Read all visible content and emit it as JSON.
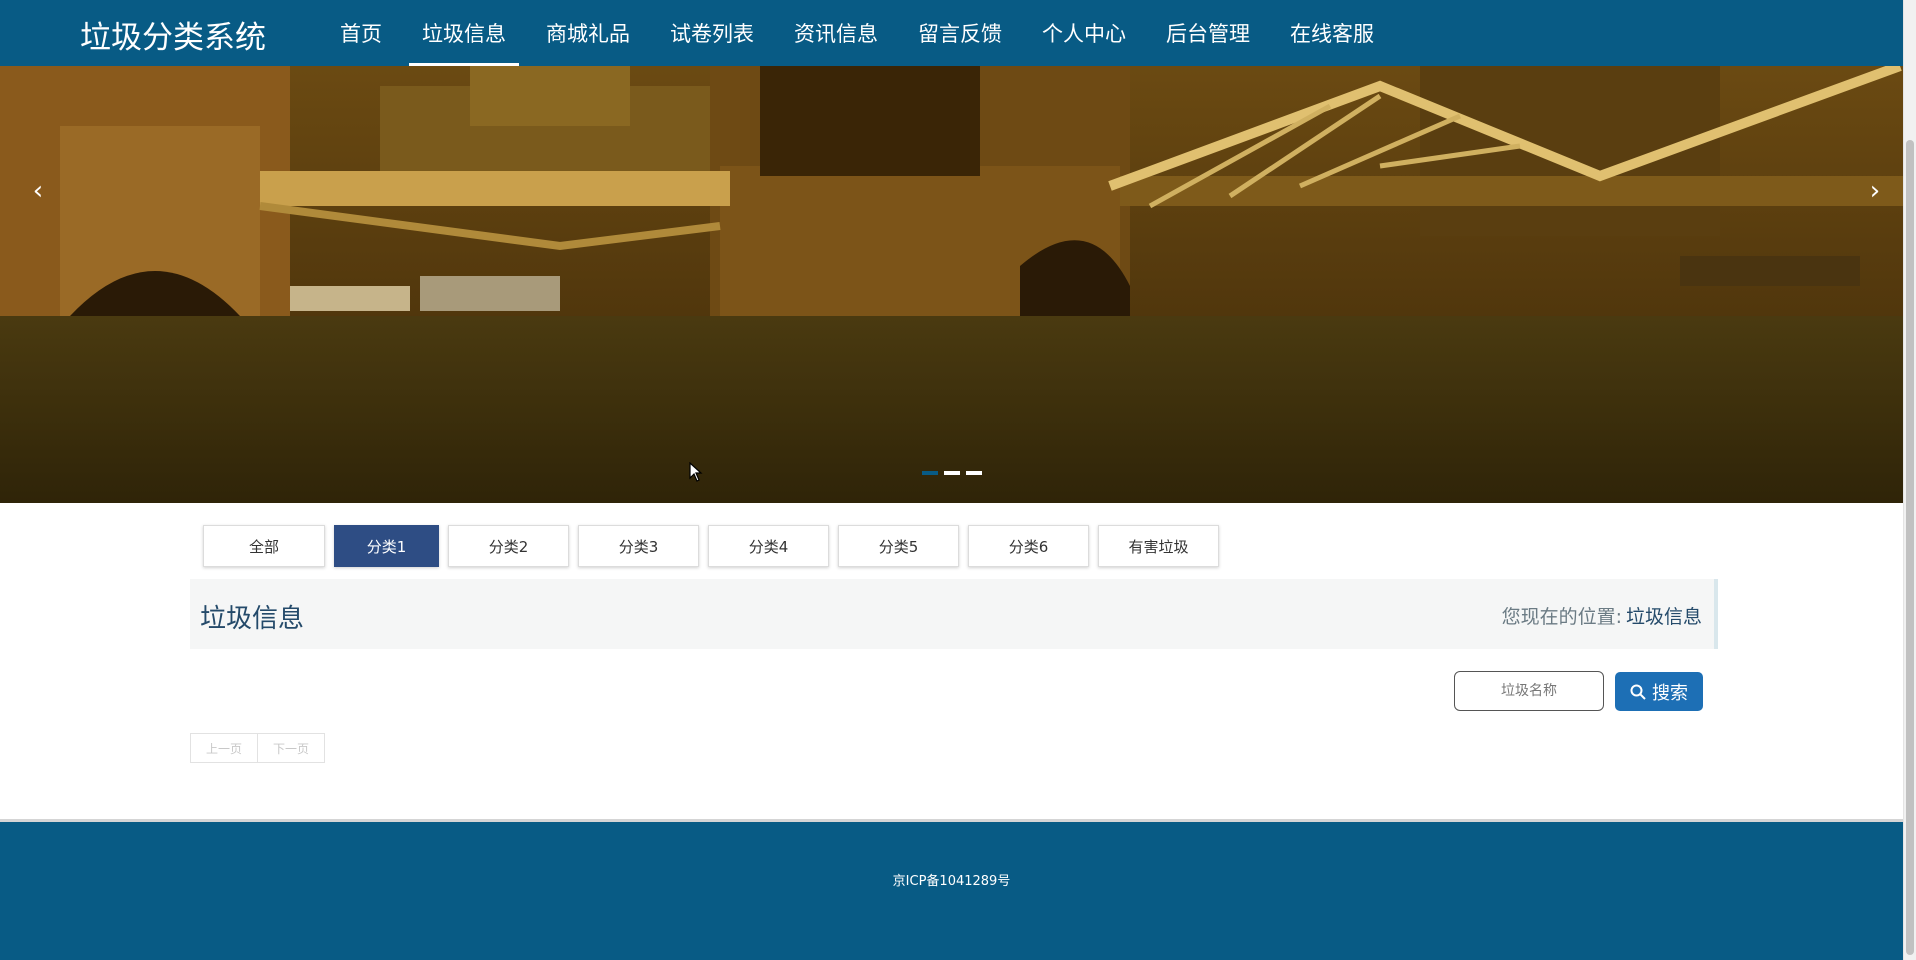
{
  "header": {
    "logo": "垃圾分类系统",
    "nav": [
      {
        "label": "首页",
        "active": false
      },
      {
        "label": "垃圾信息",
        "active": true
      },
      {
        "label": "商城礼品",
        "active": false
      },
      {
        "label": "试卷列表",
        "active": false
      },
      {
        "label": "资讯信息",
        "active": false
      },
      {
        "label": "留言反馈",
        "active": false
      },
      {
        "label": "个人中心",
        "active": false
      },
      {
        "label": "后台管理",
        "active": false
      },
      {
        "label": "在线客服",
        "active": false
      }
    ]
  },
  "banner": {
    "prev_icon": "chevron-left-icon",
    "next_icon": "chevron-right-icon",
    "slide_count": 3,
    "active_slide": 1
  },
  "categories": [
    {
      "label": "全部",
      "active": false
    },
    {
      "label": "分类1",
      "active": true
    },
    {
      "label": "分类2",
      "active": false
    },
    {
      "label": "分类3",
      "active": false
    },
    {
      "label": "分类4",
      "active": false
    },
    {
      "label": "分类5",
      "active": false
    },
    {
      "label": "分类6",
      "active": false
    },
    {
      "label": "有害垃圾",
      "active": false
    }
  ],
  "titlebar": {
    "title": "垃圾信息",
    "location_label": "您现在的位置:",
    "location_current": "垃圾信息"
  },
  "search": {
    "placeholder": "垃圾名称",
    "button_label": "搜索",
    "icon": "search-icon"
  },
  "pager": {
    "prev_label": "上一页",
    "next_label": "下一页"
  },
  "footer": {
    "icp": "京ICP备1041289号"
  },
  "colors": {
    "primary": "#085b85",
    "category_active": "#2e4d84",
    "search_button": "#1d6fb5"
  }
}
